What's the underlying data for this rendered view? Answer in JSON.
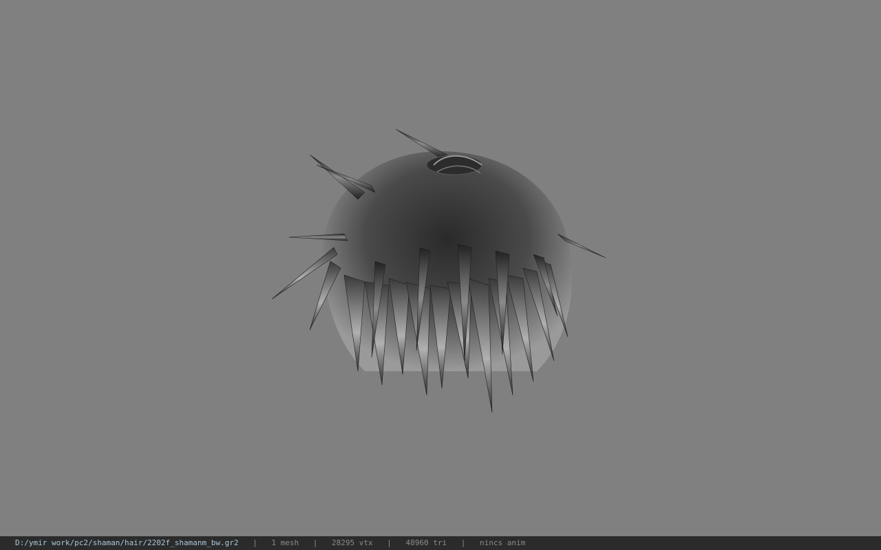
{
  "viewer": {
    "background_color": "#808080",
    "model_icon": "hair-mesh-icon"
  },
  "statusbar": {
    "file_path": "D:/ymir work/pc2/shaman/hair/2202f_shamanm_bw.gr2",
    "separator": "|",
    "mesh_count": "1 mesh",
    "vertex_count": "28295 vtx",
    "triangle_count": "48960 tri",
    "anim_status": "nincs anim"
  }
}
